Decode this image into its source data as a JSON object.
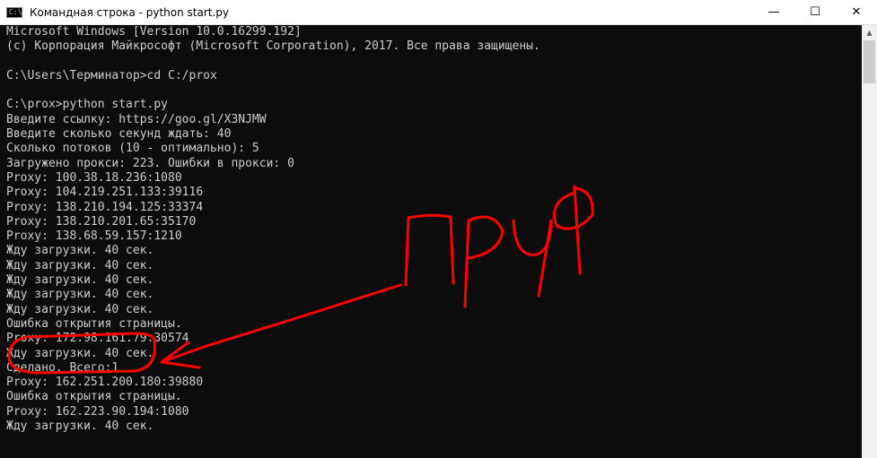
{
  "window": {
    "title": "Командная строка - python  start.py",
    "icon": "cmd-icon",
    "controls": {
      "minimize_glyph": "—",
      "maximize_glyph": "☐",
      "close_glyph": "✕"
    }
  },
  "console": {
    "background": "#0c0c0c",
    "foreground": "#cccccc",
    "lines": [
      "Microsoft Windows [Version 10.0.16299.192]",
      "(c) Корпорация Майкрософт (Microsoft Corporation), 2017. Все права защищены.",
      "",
      "C:\\Users\\Терминатор>cd C:/prox",
      "",
      "C:\\prox>python start.py",
      "Введите ссылку: https://goo.gl/X3NJMW",
      "Введите сколько секунд ждать: 40",
      "Сколько потоков (10 - оптимально): 5",
      "Загружено прокси: 223. Ошибки в прокси: 0",
      "Proxy: 100.38.18.236:1080",
      "Proxy: 104.219.251.133:39116",
      "Proxy: 138.210.194.125:33374",
      "Proxy: 138.210.201.65:35170",
      "Proxy: 138.68.59.157:1210",
      "Жду загрузки. 40 сек.",
      "Жду загрузки. 40 сек.",
      "Жду загрузки. 40 сек.",
      "Жду загрузки. 40 сек.",
      "Жду загрузки. 40 сек.",
      "Ошибка открытия страницы.",
      "Proxy: 172.98.161.79:30574",
      "Жду загрузки. 40 сек.",
      "Сделано. Всего:1",
      "Proxy: 162.251.200.180:39880",
      "Ошибка открытия страницы.",
      "Proxy: 162.223.90.194:1080",
      "Жду загрузки. 40 сек."
    ]
  },
  "scrollbar": {
    "up_arrow_glyph": "▲"
  },
  "annotation": {
    "handwritten_text": "пруф",
    "color": "#ff0000"
  }
}
